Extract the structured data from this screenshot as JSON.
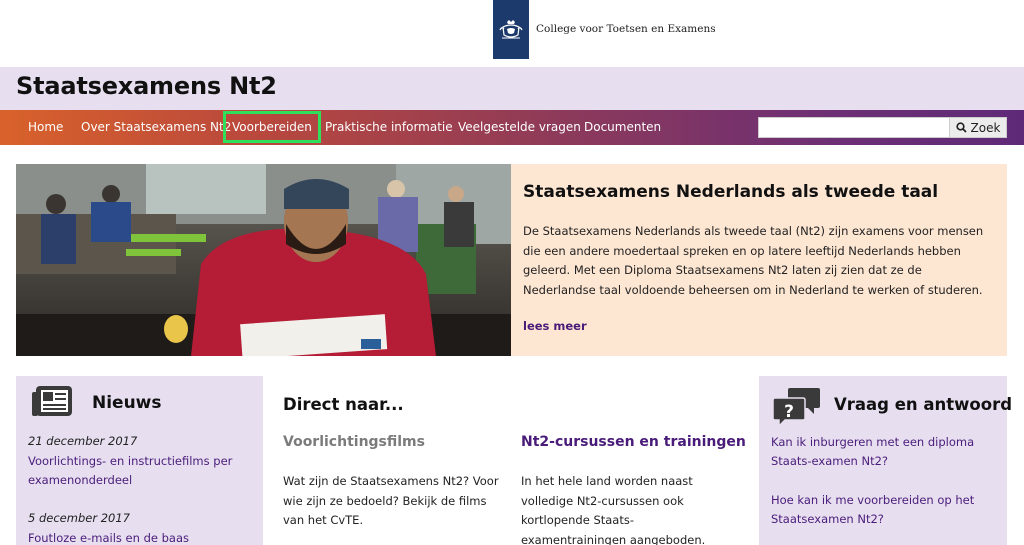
{
  "gov": {
    "org_name": "College voor Toetsen en Examens"
  },
  "site": {
    "title": "Staatsexamens Nt2"
  },
  "nav": {
    "items": [
      {
        "label": "Home"
      },
      {
        "label": "Over Staatsexamens Nt2"
      },
      {
        "label": "Voorbereiden"
      },
      {
        "label": "Praktische informatie"
      },
      {
        "label": "Veelgestelde vragen"
      },
      {
        "label": "Documenten"
      }
    ],
    "search_value": "",
    "search_button": "Zoek"
  },
  "hero": {
    "title": "Staatsexamens Nederlands als tweede taal",
    "text": "De Staatsexamens Nederlands als tweede taal (Nt2) zijn examens voor mensen die een andere moedertaal spreken en op latere leeftijd Nederlands hebben geleerd. Met een Diploma Staatsexamens Nt2 laten zij zien dat ze de Nederlandse taal voldoende beheersen om in Nederland te werken of studeren.",
    "link": "lees meer"
  },
  "news": {
    "heading": "Nieuws",
    "items": [
      {
        "date": "21 december 2017",
        "title": "Voorlichtings- en instructiefilms per examenonderdeel"
      },
      {
        "date": "5 december 2017",
        "title": "Foutloze e-mails en de baas aanspreken"
      }
    ]
  },
  "direct": {
    "heading": "Direct naar...",
    "columns": [
      {
        "title": "Voorlichtingsfilms",
        "text": "Wat zijn de Staatsexamens Nt2? Voor wie zijn ze bedoeld? Bekijk de films van het CvTE."
      },
      {
        "title": "Nt2-cursussen en trainingen",
        "text": "In het hele land worden naast volledige Nt2-cursussen ook kortlopende Staats-examentrainingen aangeboden."
      }
    ]
  },
  "qa": {
    "heading": "Vraag en antwoord",
    "items": [
      {
        "question": "Kan ik inburgeren met een diploma Staats-examen Nt2?"
      },
      {
        "question": "Hoe kan ik me voorbereiden op het Staatsexamen Nt2?"
      }
    ]
  },
  "colors": {
    "title_bar": "#e7dff0",
    "nav_start": "#d9622b",
    "nav_end": "#5e2a78",
    "hero_panel": "#fde6d2",
    "link": "#4a1c7a",
    "active_outline": "#2fe05a"
  }
}
